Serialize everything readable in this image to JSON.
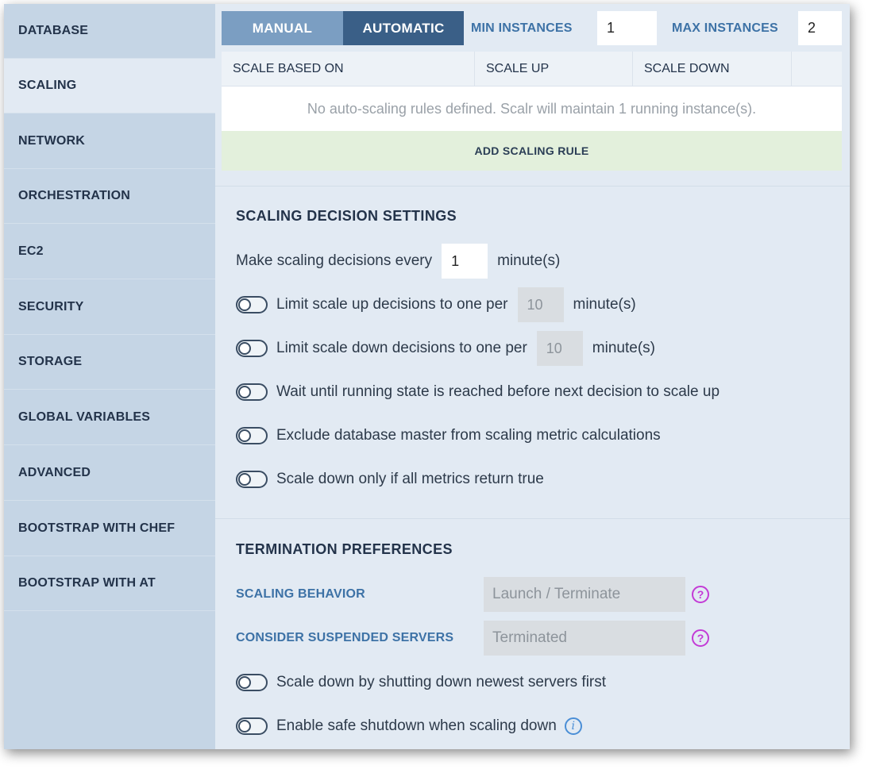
{
  "sidebar": {
    "items": [
      {
        "label": "DATABASE"
      },
      {
        "label": "SCALING"
      },
      {
        "label": "NETWORK"
      },
      {
        "label": "ORCHESTRATION"
      },
      {
        "label": "EC2"
      },
      {
        "label": "SECURITY"
      },
      {
        "label": "STORAGE"
      },
      {
        "label": "GLOBAL VARIABLES"
      },
      {
        "label": "ADVANCED"
      },
      {
        "label": "BOOTSTRAP WITH CHEF"
      },
      {
        "label": "BOOTSTRAP WITH AT"
      }
    ],
    "active": "SCALING"
  },
  "mode": {
    "manual_label": "MANUAL",
    "automatic_label": "AUTOMATIC",
    "selected": "AUTOMATIC"
  },
  "instances": {
    "min_label": "MIN INSTANCES",
    "min_value": "1",
    "max_label": "MAX INSTANCES",
    "max_value": "2"
  },
  "rules_table": {
    "columns": [
      "SCALE BASED ON",
      "SCALE UP",
      "SCALE DOWN"
    ],
    "empty_message": "No auto-scaling rules defined. Scalr will maintain 1 running instance(s).",
    "add_button": "ADD SCALING RULE"
  },
  "decision_settings": {
    "title": "SCALING DECISION SETTINGS",
    "every_prefix": "Make scaling decisions every",
    "every_value": "1",
    "every_suffix": "minute(s)",
    "limit_up_prefix": "Limit scale up decisions to one per",
    "limit_up_value": "10",
    "limit_up_suffix": "minute(s)",
    "limit_down_prefix": "Limit scale down decisions to one per",
    "limit_down_value": "10",
    "limit_down_suffix": "minute(s)",
    "wait_running": "Wait until running state is reached before next decision to scale up",
    "exclude_master": "Exclude database master from scaling metric calculations",
    "all_metrics": "Scale down only if all metrics return true"
  },
  "termination": {
    "title": "TERMINATION PREFERENCES",
    "behavior_label": "SCALING BEHAVIOR",
    "behavior_value": "Launch / Terminate",
    "suspended_label": "CONSIDER SUSPENDED SERVERS",
    "suspended_value": "Terminated",
    "help_glyph": "?",
    "newest_first": "Scale down by shutting down newest servers first",
    "safe_shutdown": "Enable safe shutdown when scaling down",
    "info_glyph": "i"
  },
  "colors": {
    "sidebar_bg": "#c5d5e5",
    "active_bg": "#e2eaf3",
    "segment_automatic": "#3a5f87",
    "segment_manual": "#7b9ec2",
    "label_blue": "#3d72a6",
    "add_rule_bg": "#e3f0dc",
    "help_icon": "#c33bd6",
    "info_icon": "#4a8ed6"
  }
}
